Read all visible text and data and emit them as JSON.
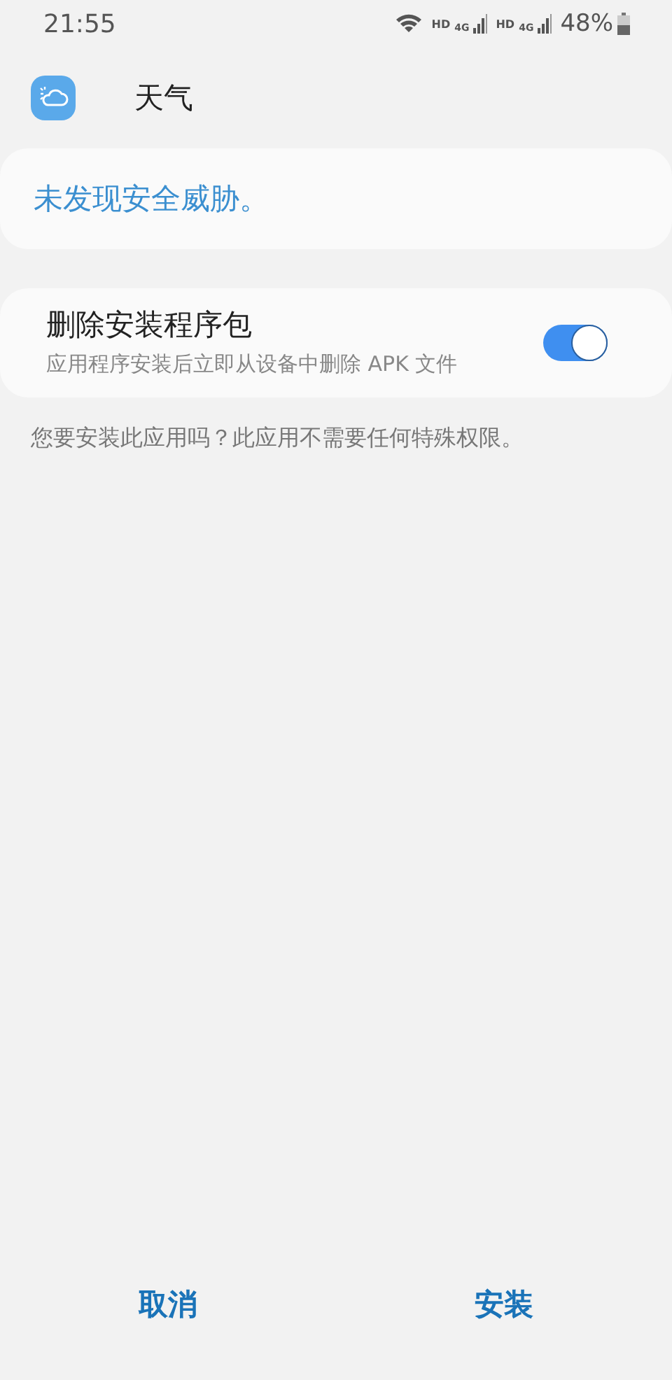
{
  "status_bar": {
    "time": "21:55",
    "sims": [
      {
        "hd": "HD",
        "network": "4G"
      },
      {
        "hd": "HD",
        "network": "4G"
      }
    ],
    "battery": "48%"
  },
  "app": {
    "name": "天气"
  },
  "security": {
    "message": "未发现安全威胁。"
  },
  "option": {
    "title": "删除安装程序包",
    "description": "应用程序安装后立即从设备中删除 APK 文件",
    "on": true
  },
  "prompt": "您要安装此应用吗？此应用不需要任何特殊权限。",
  "buttons": [
    {
      "label": "取消"
    },
    {
      "label": "安装"
    }
  ]
}
